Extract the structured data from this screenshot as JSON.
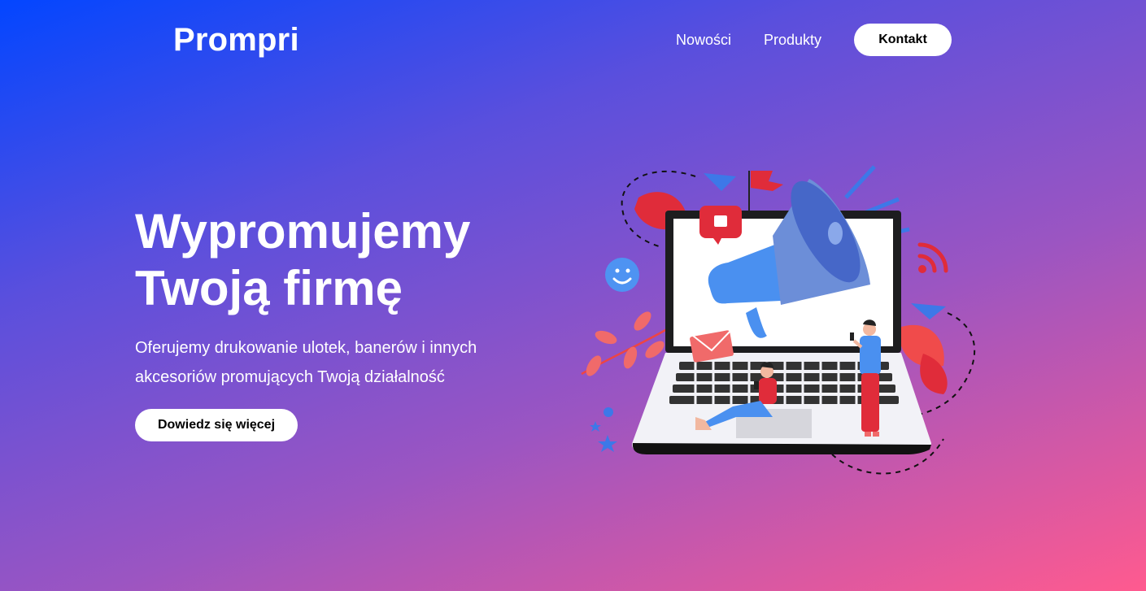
{
  "header": {
    "logo": "Prompri",
    "nav": [
      {
        "label": "Nowości"
      },
      {
        "label": "Produkty"
      }
    ],
    "contact_label": "Kontakt"
  },
  "hero": {
    "title_line1": "Wypromujemy",
    "title_line2": "Twoją firmę",
    "description_line1": "Oferujemy drukowanie ulotek, banerów i innych",
    "description_line2": "akcesoriów promujących Twoją działalność",
    "cta_label": "Dowiedz się więcej"
  },
  "illustration": {
    "subject": "laptop-with-megaphone",
    "colors": {
      "laptop": "#1d1d1f",
      "screen": "#ffffff",
      "megaphone": "#4a90f0",
      "accent": "#e8283a",
      "leaf": "#ef6a6a"
    }
  },
  "colors": {
    "gradient_start": "#0346ff",
    "gradient_end": "#ff5a8f",
    "button_bg": "#ffffff",
    "button_text": "#000000"
  }
}
